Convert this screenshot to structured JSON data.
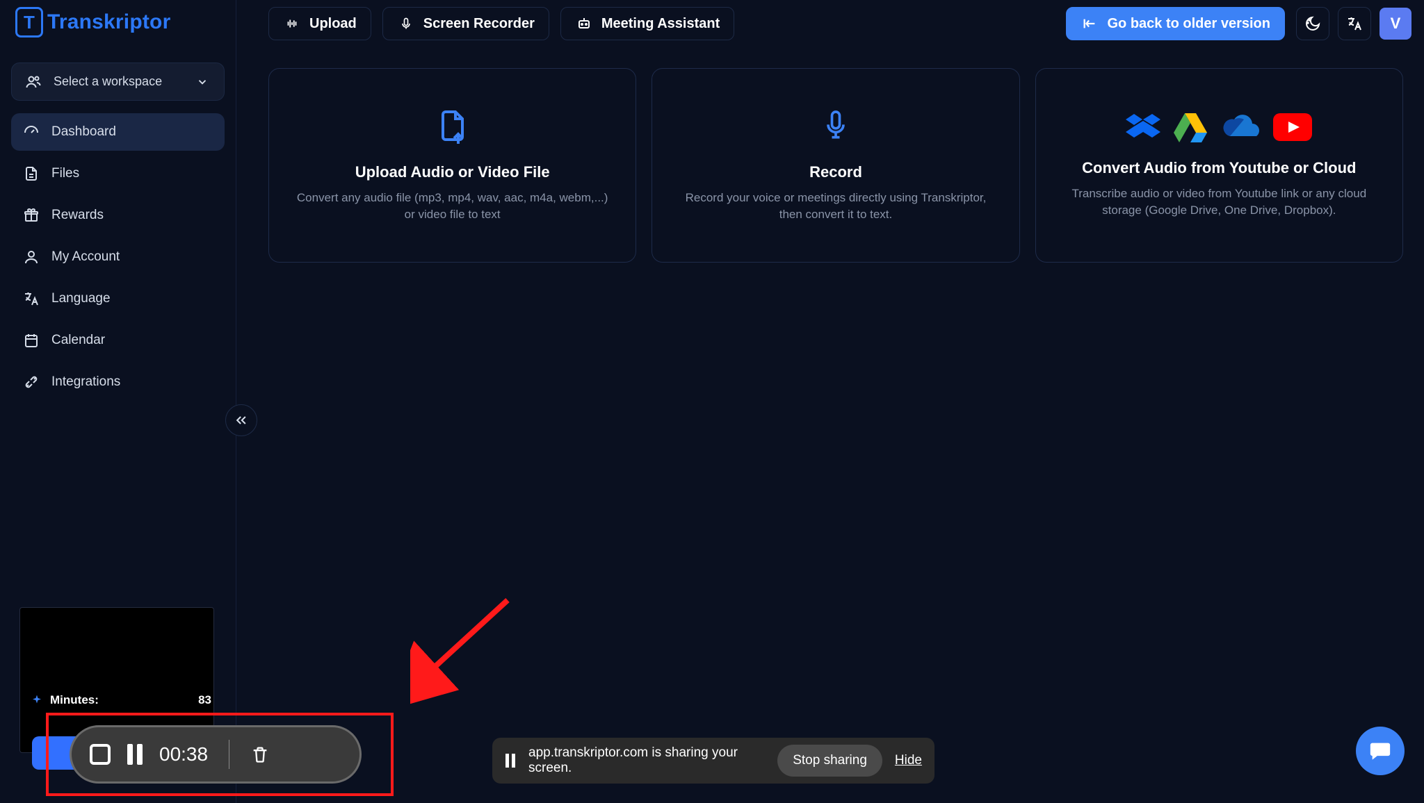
{
  "brand": {
    "name": "Transkriptor",
    "mark": "T"
  },
  "sidebar": {
    "workspace_label": "Select a workspace",
    "items": [
      {
        "label": "Dashboard"
      },
      {
        "label": "Files"
      },
      {
        "label": "Rewards"
      },
      {
        "label": "My Account"
      },
      {
        "label": "Language"
      },
      {
        "label": "Calendar"
      },
      {
        "label": "Integrations"
      }
    ]
  },
  "topbar": {
    "upload": "Upload",
    "recorder": "Screen Recorder",
    "meeting": "Meeting Assistant",
    "go_back": "Go back to older version",
    "avatar_initial": "V"
  },
  "cards": {
    "upload": {
      "title": "Upload Audio or Video File",
      "desc": "Convert any audio file (mp3, mp4, wav, aac, m4a, webm,...) or video file to text"
    },
    "record": {
      "title": "Record",
      "desc": "Record your voice or meetings directly using Transkriptor, then convert it to text."
    },
    "cloud": {
      "title": "Convert Audio from Youtube or Cloud",
      "desc": "Transcribe audio or video from Youtube link or any cloud storage (Google Drive, One Drive, Dropbox)."
    }
  },
  "minutes": {
    "label": "Minutes:",
    "value": "83"
  },
  "recorder_bar": {
    "time": "00:38"
  },
  "share_bar": {
    "message": "app.transkriptor.com is sharing your screen.",
    "stop": "Stop sharing",
    "hide": "Hide"
  }
}
